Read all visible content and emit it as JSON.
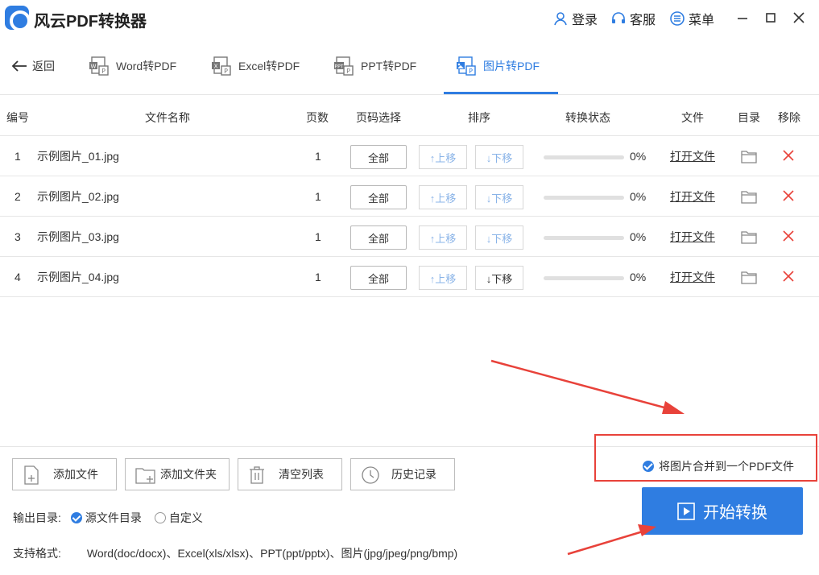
{
  "app": {
    "title": "风云PDF转换器"
  },
  "titlebar": {
    "login": "登录",
    "service": "客服",
    "menu": "菜单"
  },
  "nav": {
    "back": "返回",
    "tabs": [
      {
        "label": "Word转PDF"
      },
      {
        "label": "Excel转PDF"
      },
      {
        "label": "PPT转PDF"
      },
      {
        "label": "图片转PDF"
      }
    ]
  },
  "table": {
    "headers": {
      "index": "编号",
      "name": "文件名称",
      "pages": "页数",
      "page_select": "页码选择",
      "sort": "排序",
      "status": "转换状态",
      "file": "文件",
      "dir": "目录",
      "remove": "移除"
    },
    "rows": [
      {
        "index": "1",
        "name": "示例图片_01.jpg",
        "pages": "1",
        "page_select": "全部",
        "up": "↑上移",
        "down": "↓下移",
        "progress": 0,
        "percent": "0%",
        "open": "打开文件",
        "up_enabled": false,
        "down_enabled": false
      },
      {
        "index": "2",
        "name": "示例图片_02.jpg",
        "pages": "1",
        "page_select": "全部",
        "up": "↑上移",
        "down": "↓下移",
        "progress": 0,
        "percent": "0%",
        "open": "打开文件",
        "up_enabled": false,
        "down_enabled": false
      },
      {
        "index": "3",
        "name": "示例图片_03.jpg",
        "pages": "1",
        "page_select": "全部",
        "up": "↑上移",
        "down": "↓下移",
        "progress": 0,
        "percent": "0%",
        "open": "打开文件",
        "up_enabled": false,
        "down_enabled": false
      },
      {
        "index": "4",
        "name": "示例图片_04.jpg",
        "pages": "1",
        "page_select": "全部",
        "up": "↑上移",
        "down": "↓下移",
        "progress": 0,
        "percent": "0%",
        "open": "打开文件",
        "up_enabled": false,
        "down_enabled": true
      }
    ]
  },
  "actions": {
    "add_file": "添加文件",
    "add_folder": "添加文件夹",
    "clear_list": "清空列表",
    "history": "历史记录"
  },
  "output": {
    "label": "输出目录:",
    "source_dir": "源文件目录",
    "custom": "自定义",
    "selected": "source_dir"
  },
  "formats": {
    "label": "支持格式:",
    "value": "Word(doc/docx)、Excel(xls/xlsx)、PPT(ppt/pptx)、图片(jpg/jpeg/png/bmp)"
  },
  "merge": {
    "label": "将图片合并到一个PDF文件",
    "checked": true
  },
  "start": {
    "label": "开始转换"
  },
  "colors": {
    "accent": "#2f7de1",
    "annotation": "#e8423a"
  }
}
